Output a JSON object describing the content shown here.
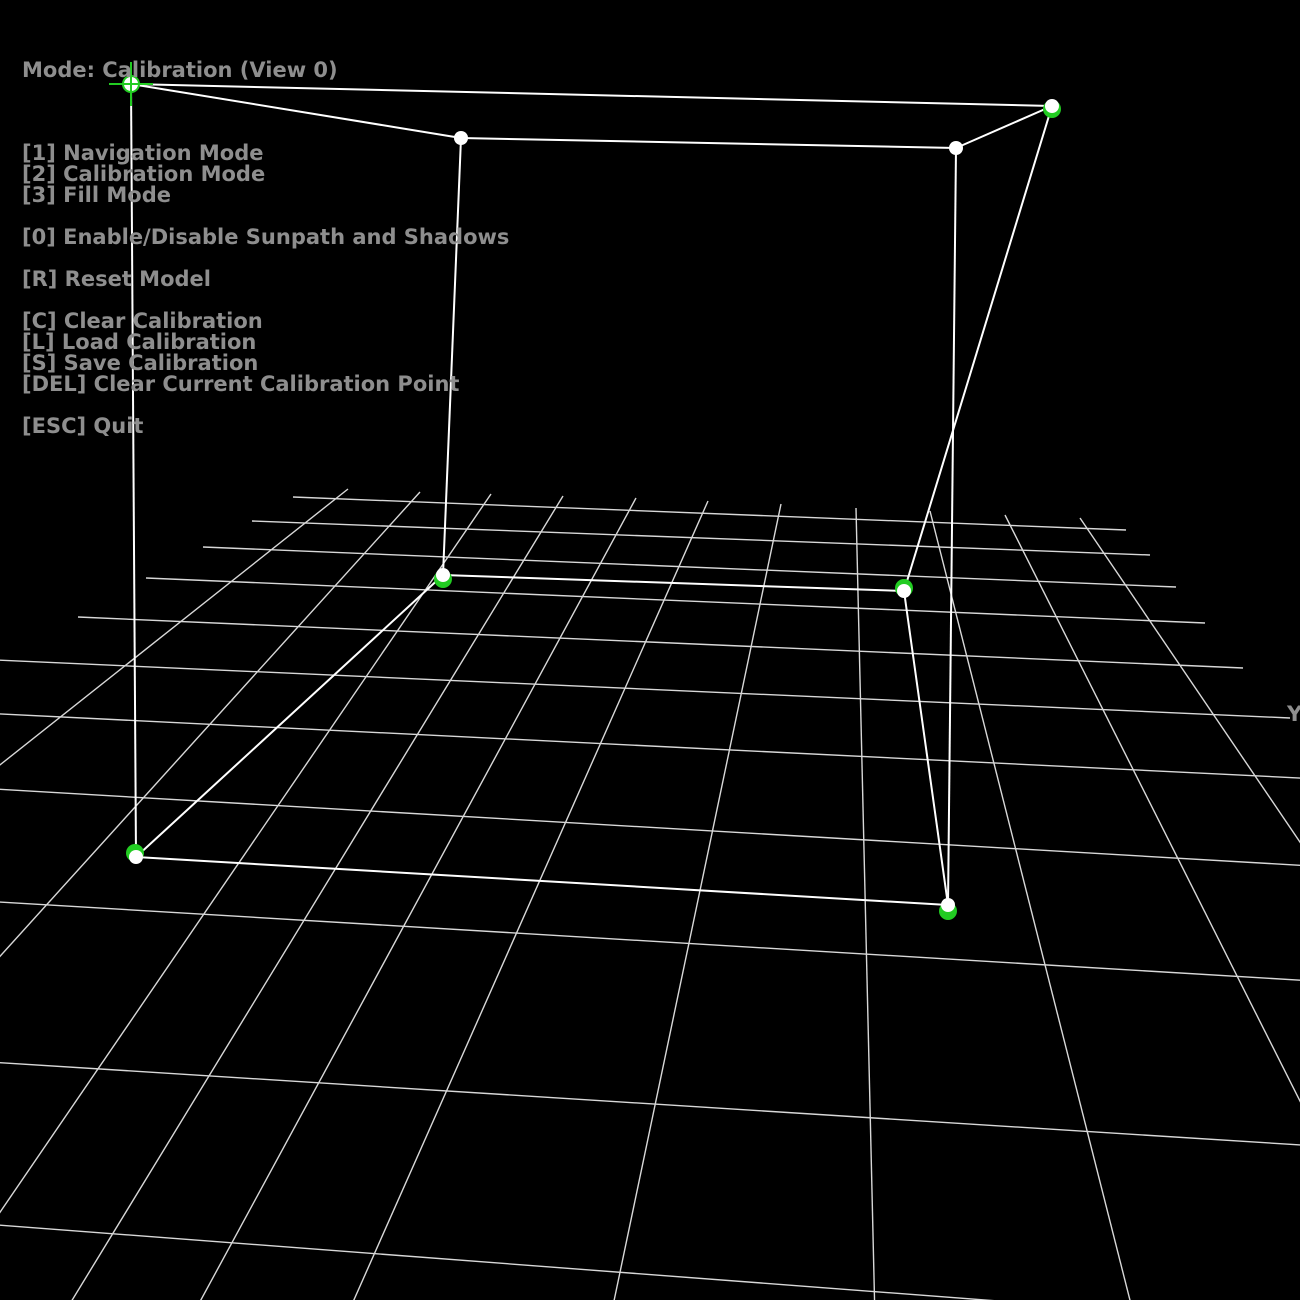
{
  "mode_line": "Mode: Calibration (View 0)",
  "menu_groups": [
    [
      {
        "key": "[1] Navigation Mode",
        "name": "menu-navigation-mode"
      },
      {
        "key": "[2] Calibration Mode",
        "name": "menu-calibration-mode"
      },
      {
        "key": "[3] Fill Mode",
        "name": "menu-fill-mode"
      }
    ],
    [
      {
        "key": "[0] Enable/Disable Sunpath and Shadows",
        "name": "menu-toggle-sunpath"
      }
    ],
    [
      {
        "key": "[R] Reset Model",
        "name": "menu-reset-model"
      }
    ],
    [
      {
        "key": "[C] Clear Calibration",
        "name": "menu-clear-calibration"
      },
      {
        "key": "[L] Load Calibration",
        "name": "menu-load-calibration"
      },
      {
        "key": "[S] Save Calibration",
        "name": "menu-save-calibration"
      },
      {
        "key": "[DEL] Clear Current Calibration Point",
        "name": "menu-clear-point"
      }
    ],
    [
      {
        "key": "[ESC] Quit",
        "name": "menu-quit"
      }
    ]
  ],
  "axis_label": "Y",
  "colors": {
    "background": "#000000",
    "hud_text": "#8e8e8e",
    "grid": "#d8d8d8",
    "wire": "#ffffff",
    "calibration_point": "#22cc22"
  }
}
